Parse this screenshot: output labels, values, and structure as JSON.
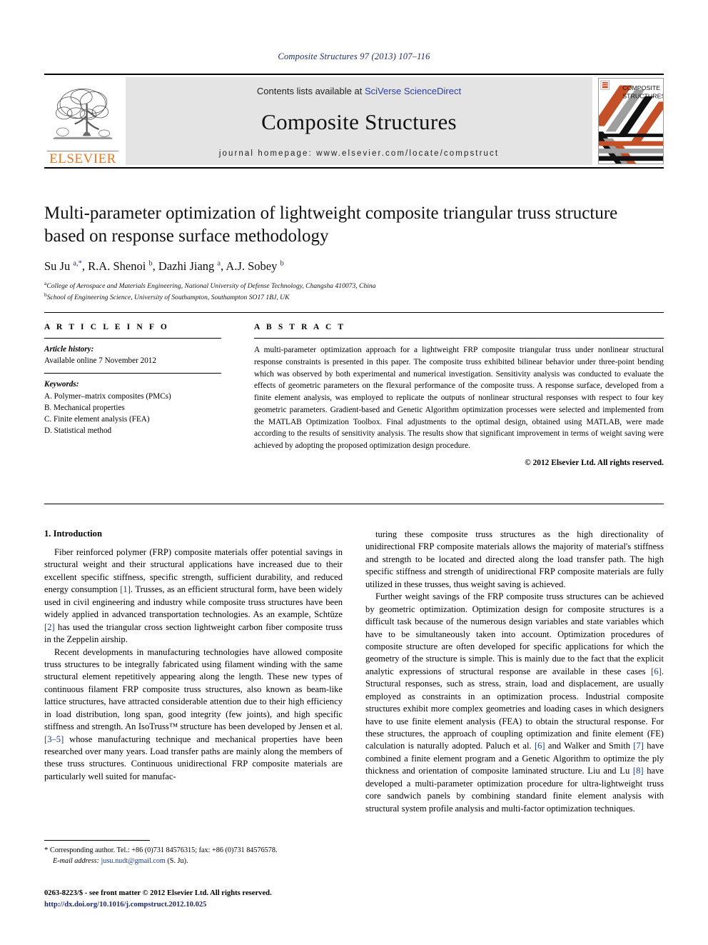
{
  "running_head": "Composite Structures 97 (2013) 107–116",
  "masthead": {
    "elsevier_wordmark": "ELSEVIER",
    "contents_prefix": "Contents lists available at ",
    "sciencedirect_link": "SciVerse ScienceDirect",
    "journal_name": "Composite Structures",
    "homepage": "journal homepage: www.elsevier.com/locate/compstruct",
    "cover_title_line1": "COMPOSITE",
    "cover_title_line2": "STRUCTURES",
    "accent_orange": "#C4502A",
    "accent_gray": "#9E9E9E",
    "elsevier_orange": "#E87722",
    "link_blue": "#2b3ea8"
  },
  "article": {
    "title": "Multi-parameter optimization of lightweight composite triangular truss structure based on response surface methodology",
    "authors_html": "Su Ju <sup>a,*</sup>, R.A. Shenoi <sup>b</sup>, Dazhi Jiang <sup>a</sup>, A.J. Sobey <sup>b</sup>",
    "affiliation_a": "College of Aerospace and Materials Engineering, National University of Defense Technology, Changsha 410073, China",
    "affiliation_b": "School of Engineering Science, University of Southampton, Southampton SO17 1BJ, UK"
  },
  "article_info": {
    "heading": "A R T I C L E    I N F O",
    "history_label": "Article history:",
    "history_value": "Available online 7 November 2012",
    "keywords_label": "Keywords:",
    "keywords": [
      "A. Polymer–matrix composites (PMCs)",
      "B. Mechanical properties",
      "C. Finite element analysis (FEA)",
      "D. Statistical method"
    ]
  },
  "abstract": {
    "heading": "A B S T R A C T",
    "text": "A multi-parameter optimization approach for a lightweight FRP composite triangular truss under nonlinear structural response constraints is presented in this paper. The composite truss exhibited bilinear behavior under three-point bending which was observed by both experimental and numerical investigation. Sensitivity analysis was conducted to evaluate the effects of geometric parameters on the flexural performance of the composite truss. A response surface, developed from a finite element analysis, was employed to replicate the outputs of nonlinear structural responses with respect to four key geometric parameters. Gradient-based and Genetic Algorithm optimization processes were selected and implemented from the MATLAB Optimization Toolbox. Final adjustments to the optimal design, obtained using MATLAB, were made according to the results of sensitivity analysis. The results show that significant improvement in terms of weight saving were achieved by adopting the proposed optimization design procedure.",
    "copyright": "© 2012 Elsevier Ltd. All rights reserved."
  },
  "body": {
    "section_title": "1. Introduction",
    "left_paragraphs": [
      {
        "segments": [
          {
            "t": "Fiber reinforced polymer (FRP) composite materials offer potential savings in structural weight and their structural applications have increased due to their excellent specific stiffness, specific strength, sufficient durability, and reduced energy consumption "
          },
          {
            "t": "[1]",
            "ref": true
          },
          {
            "t": ". Trusses, as an efficient structural form, have been widely used in civil engineering and industry while composite truss structures have been widely applied in advanced transportation technologies. As an example, Schtüze "
          },
          {
            "t": "[2]",
            "ref": true
          },
          {
            "t": " has used the triangular cross section lightweight carbon fiber composite truss in the Zeppelin airship."
          }
        ]
      },
      {
        "segments": [
          {
            "t": "Recent developments in manufacturing technologies have allowed composite truss structures to be integrally fabricated using filament winding with the same structural element repetitively appearing along the length. These new types of continuous filament FRP composite truss structures, also known as beam-like lattice structures, have attracted considerable attention due to their high efficiency in load distribution, long span, good integrity (few joints), and high specific stiffness and strength. An IsoTruss™ structure has been developed by Jensen et al. "
          },
          {
            "t": "[3–5]",
            "ref": true
          },
          {
            "t": " whose manufacturing technique and mechanical properties have been researched over many years. Load transfer paths are mainly along the members of these truss structures. Continuous unidirectional FRP composite materials are particularly well suited for manufac-"
          }
        ]
      }
    ],
    "right_paragraphs": [
      {
        "segments": [
          {
            "t": "turing these composite truss structures as the high directionality of unidirectional FRP composite materials allows the majority of material's stiffness and strength to be located and directed along the load transfer path. The high specific stiffness and strength of unidirectional FRP composite materials are fully utilized in these trusses, thus weight saving is achieved."
          }
        ],
        "noindent": false
      },
      {
        "segments": [
          {
            "t": "Further weight savings of the FRP composite truss structures can be achieved by geometric optimization. Optimization design for composite structures is a difficult task because of the numerous design variables and state variables which have to be simultaneously taken into account. Optimization procedures of composite structure are often developed for specific applications for which the geometry of the structure is simple. This is mainly due to the fact that the explicit analytic expressions of structural response are available in these cases "
          },
          {
            "t": "[6]",
            "ref": true
          },
          {
            "t": ". Structural responses, such as stress, strain, load and displacement, are usually employed as constraints in an optimization process. Industrial composite structures exhibit more complex geometries and loading cases in which designers have to use finite element analysis (FEA) to obtain the structural response. For these structures, the approach of coupling optimization and finite element (FE) calculation is naturally adopted. Paluch et al. "
          },
          {
            "t": "[6]",
            "ref": true
          },
          {
            "t": " and Walker and Smith "
          },
          {
            "t": "[7]",
            "ref": true
          },
          {
            "t": " have combined a finite element program and a Genetic Algorithm to optimize the ply thickness and orientation of composite laminated structure. Liu and Lu "
          },
          {
            "t": "[8]",
            "ref": true
          },
          {
            "t": " have developed a multi-parameter optimization procedure for ultra-lightweight truss core sandwich panels by combining standard finite element analysis with structural system profile analysis and multi-factor optimization techniques."
          }
        ],
        "noindent": false
      }
    ]
  },
  "footnotes": {
    "corresponding_star": "*",
    "corresponding_text": "Corresponding author. Tel.: +86 (0)731 84576315; fax: +86 (0)731 84576578.",
    "email_label": "E-mail address:",
    "email_address": "jusu.nudt@gmail.com",
    "email_suffix": "(S. Ju)."
  },
  "imprint": {
    "issn_line": "0263-8223/$ - see front matter © 2012 Elsevier Ltd. All rights reserved.",
    "doi": "http://dx.doi.org/10.1016/j.compstruct.2012.10.025"
  }
}
